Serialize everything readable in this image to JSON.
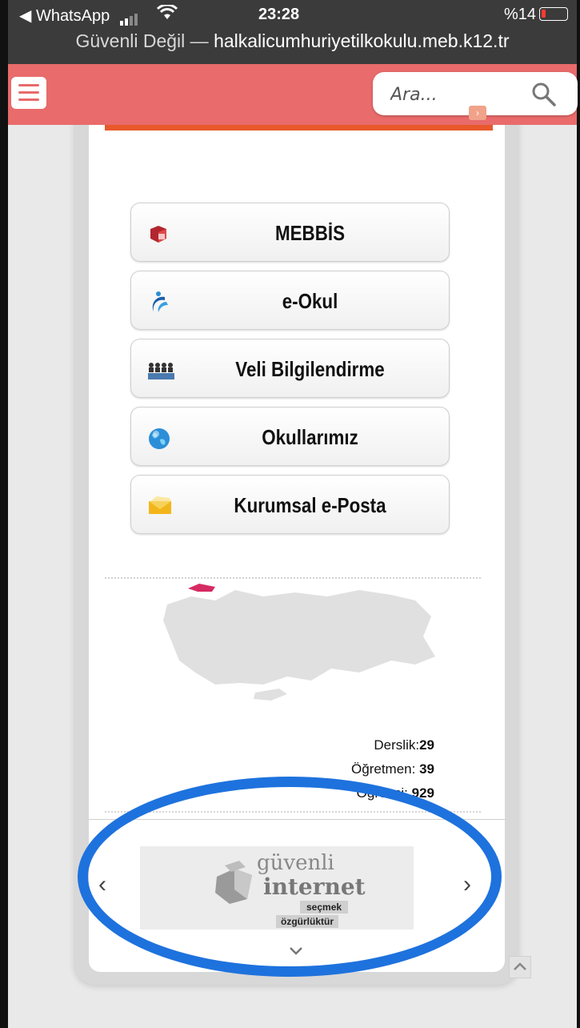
{
  "status_bar": {
    "back_label": "◀ WhatsApp",
    "time": "23:28",
    "battery": "%14"
  },
  "address_bar": {
    "security": "Güvenli Değil",
    "separator": " — ",
    "domain": "halkalicumhuriyetilkokulu.meb.k12.tr"
  },
  "header": {
    "search_placeholder": "Ara..."
  },
  "links": [
    {
      "label": "MEBBİS",
      "icon": "mebbis-icon"
    },
    {
      "label": "e-Okul",
      "icon": "eokul-icon"
    },
    {
      "label": "Veli Bilgilendirme",
      "icon": "parents-icon"
    },
    {
      "label": "Okullarımız",
      "icon": "globe-icon"
    },
    {
      "label": "Kurumsal e-Posta",
      "icon": "envelope-icon"
    }
  ],
  "stats": {
    "classrooms_label": "Derslik:",
    "classrooms_value": "29",
    "teachers_label": "Öğretmen: ",
    "teachers_value": "39",
    "students_label": "Öğrenci: ",
    "students_value": "929"
  },
  "carousel": {
    "line1": "güvenli",
    "line2": "internet",
    "tag1": "seçmek",
    "tag2": "özgürlüktür"
  },
  "colors": {
    "header": "#e96b6b",
    "accent_line": "#e8582a",
    "annotation": "#1e72dd"
  }
}
